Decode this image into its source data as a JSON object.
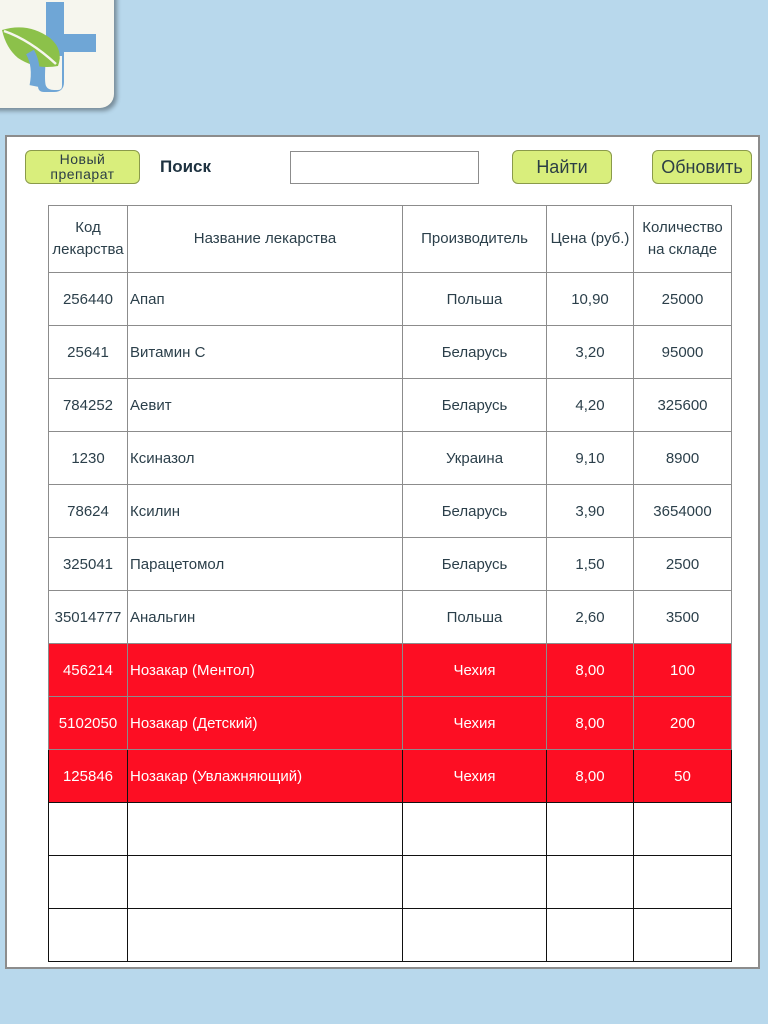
{
  "toolbar": {
    "new_label": "Новый препарат",
    "search_label": "Поиск",
    "search_value": "",
    "find_label": "Найти",
    "refresh_label": "Обновить"
  },
  "table": {
    "columns": [
      "Код лекарства",
      "Название лекарства",
      "Производитель",
      "Цена (руб.)",
      "Количество на складе"
    ],
    "rows": [
      {
        "code": "256440",
        "name": "Апап",
        "maker": "Польша",
        "price": "10,90",
        "qty": "25000",
        "alert": false
      },
      {
        "code": "25641",
        "name": "Витамин С",
        "maker": "Беларусь",
        "price": "3,20",
        "qty": "95000",
        "alert": false
      },
      {
        "code": "784252",
        "name": "Аевит",
        "maker": "Беларусь",
        "price": "4,20",
        "qty": "325600",
        "alert": false
      },
      {
        "code": "1230",
        "name": "Ксиназол",
        "maker": "Украина",
        "price": "9,10",
        "qty": "8900",
        "alert": false
      },
      {
        "code": "78624",
        "name": "Ксилин",
        "maker": "Беларусь",
        "price": "3,90",
        "qty": "3654000",
        "alert": false
      },
      {
        "code": "325041",
        "name": "Парацетомол",
        "maker": "Беларусь",
        "price": "1,50",
        "qty": "2500",
        "alert": false
      },
      {
        "code": "35014777",
        "name": "Анальгин",
        "maker": "Польша",
        "price": "2,60",
        "qty": "3500",
        "alert": false
      },
      {
        "code": "456214",
        "name": "Нозакар (Ментол)",
        "maker": "Чехия",
        "price": "8,00",
        "qty": "100",
        "alert": true
      },
      {
        "code": "5102050",
        "name": "Нозакар (Детский)",
        "maker": "Чехия",
        "price": "8,00",
        "qty": "200",
        "alert": true
      },
      {
        "code": "125846",
        "name": "Нозакар (Увлажняющий)",
        "maker": "Чехия",
        "price": "8,00",
        "qty": "50",
        "alert": true,
        "boxed": true
      }
    ],
    "empty_rows": 3
  },
  "colors": {
    "background": "#b8d8ec",
    "button": "#d9ee7c",
    "alert_row": "#fd0e23",
    "logo_cross": "#6fa6d6",
    "logo_leaf": "#8cc14a"
  },
  "icons": {
    "logo": "medical-cross-leaf-icon"
  }
}
